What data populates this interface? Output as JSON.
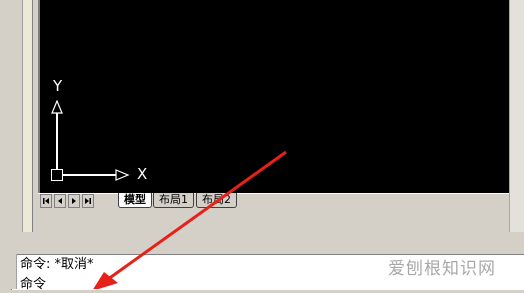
{
  "canvas": {
    "ucs": {
      "y_label": "Y",
      "x_label": "X"
    }
  },
  "tabs": {
    "nav_icons": [
      "first-icon",
      "prev-icon",
      "next-icon",
      "last-icon"
    ],
    "items": [
      {
        "label": "模型",
        "active": true
      },
      {
        "label": "布局1",
        "active": false
      },
      {
        "label": "布局2",
        "active": false
      }
    ]
  },
  "command": {
    "line1": "命令: *取消*",
    "line2": "命令"
  },
  "watermark": {
    "text": "爱刨根知识网"
  },
  "colors": {
    "canvas_bg": "#000000",
    "annotation_arrow": "#e8201a",
    "ui_bg": "#d4d0c8"
  }
}
